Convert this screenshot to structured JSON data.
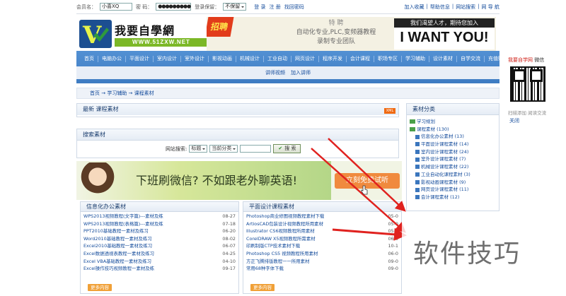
{
  "topbar": {
    "member_label": "会员名：",
    "member_value": "小喜XQ",
    "pwd_label": "密 码：",
    "pwd_value": "●●●●●●●●●",
    "keep_label": "登录保留：",
    "keep_value": "不保留",
    "login": "登 录",
    "register": "注 册",
    "forgot": "找回密码",
    "fav": "加入收藏",
    "help": "帮助信息",
    "search": "网站搜索",
    "nav": "网 导 航"
  },
  "logo": {
    "title": "我要自學網",
    "url": "WWW.51ZXW.NET"
  },
  "banner": {
    "hire": "招聘",
    "line1": "特 聘",
    "line2": "自动化专业,PLC,变频器教程",
    "line3": "录制专业团队",
    "tag": "我们渴望人才，期待您加入",
    "big": "I WANT YOU!"
  },
  "nav": {
    "items": [
      "首页",
      "电脑办公",
      "平面设计",
      "室内设计",
      "室外设计",
      "影视动画",
      "机械设计",
      "工业自动",
      "网页设计",
      "程序开发",
      "会计课程",
      "职场专区",
      "学习辅助",
      "设计素材",
      "自学交流",
      "充值购买"
    ],
    "row2": [
      "讲师视频",
      "加入讲师"
    ]
  },
  "breadcrumb": "首页 → 学习辅助 → 课程素材",
  "latest": {
    "title": "最新  课程素材",
    "xml": "XML"
  },
  "search": {
    "title": "搜索素材",
    "label": "网站搜索:",
    "field": "标题",
    "scope": "当前分类",
    "button": "搜 索"
  },
  "ad": {
    "text": "下班刷微信? 不如跟老外聊英语!",
    "cta": "立刻免费试听"
  },
  "list_left": {
    "title": "信息化办公素材",
    "more": "更多内容",
    "items": [
      [
        "WPS2013视频教程(文字篇)---素材及练",
        "08-27"
      ],
      [
        "WPS2013视频教程(表格篇)---素材及练",
        "07-18"
      ],
      [
        "PPT2010基础教程一素材及练习",
        "06-20"
      ],
      [
        "Word2010基础教程一素材及练习",
        "08-02"
      ],
      [
        "Excel2010基础教程一素材及练习",
        "06-07"
      ],
      [
        "Excel数据透视表教程一素材及练习",
        "04-25"
      ],
      [
        "Excel VBA基础教程一素材及练习",
        "04-10"
      ],
      [
        "Excel操作技巧视频教程一素材及练",
        "09-17"
      ]
    ]
  },
  "list_right": {
    "title": "平面设计课程素材",
    "more": "更多内容",
    "items": [
      [
        "Photoshop商业修图视频教程素材下载",
        "05-0"
      ],
      [
        "ArtiosCAD包装设计视频教程所用素材",
        "05-0"
      ],
      [
        "Illustrator CS6视频教程所用素材",
        "05-0"
      ],
      [
        "CorelDRAW X5视频教程所需素材",
        "06-0"
      ],
      [
        "印刷制版CTP技术素材下载",
        "10-1"
      ],
      [
        "Photoshop CS5 视频教程所用素材",
        "06-0"
      ],
      [
        "方正飞腾排版教程一一所用素材",
        "09-0"
      ],
      [
        "常用68种字体下载",
        "09-0"
      ]
    ]
  },
  "side": {
    "title": "素材分类",
    "items": [
      {
        "label": "学习规划",
        "level": 0
      },
      {
        "label": "课程素材 (130)",
        "level": 0
      },
      {
        "label": "信息化办公素材 (13)",
        "level": 1
      },
      {
        "label": "平面设计课程素材 (14)",
        "level": 1
      },
      {
        "label": "室内设计课程素材 (24)",
        "level": 1
      },
      {
        "label": "室外设计课程素材 (7)",
        "level": 1
      },
      {
        "label": "机械设计课程素材 (22)",
        "level": 1
      },
      {
        "label": "工业自动化课程素材 (3)",
        "level": 1
      },
      {
        "label": "影视动画课程素材 (9)",
        "level": 1
      },
      {
        "label": "网页设计课程素材 (11)",
        "level": 1
      },
      {
        "label": "会计课程素材 (12)",
        "level": 1
      }
    ]
  },
  "rightbox": {
    "brand": "我要自学网",
    "suffix": " 微信",
    "caption": "扫描添加  阅读交流",
    "close": "关闭"
  },
  "watermark": "软件技巧",
  "colors": {
    "nav": "#4a87cb",
    "accent": "#f0a037",
    "arrow": "#e0221f"
  }
}
